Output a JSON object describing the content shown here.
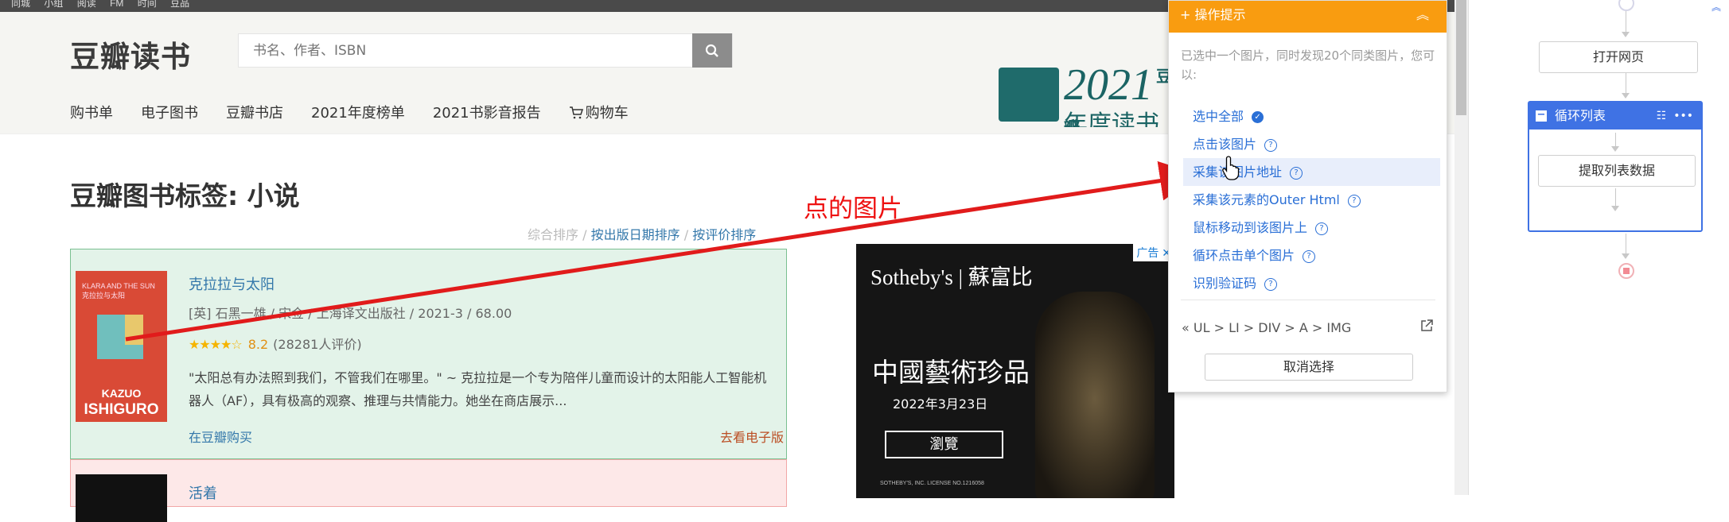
{
  "topbar": {
    "links": [
      "同城",
      "小组",
      "阅读",
      "FM",
      "时间",
      "豆品"
    ]
  },
  "header": {
    "logo": "豆瓣读书",
    "search": {
      "placeholder": "书名、作者、ISBN"
    },
    "nav": [
      "购书单",
      "电子图书",
      "豆瓣书店",
      "2021年度榜单",
      "2021书影音报告",
      "购物车"
    ]
  },
  "banner": {
    "year": "2021",
    "brand": "豆瓣",
    "subtitle": "年度读书榜单"
  },
  "main": {
    "title": "豆瓣图书标签: 小说",
    "sort": {
      "overall": "综合排序",
      "sep": "/",
      "by_date": "按出版日期排序",
      "by_rating": "按评价排序"
    },
    "books": [
      {
        "title": "克拉拉与太阳",
        "pub": "[英] 石黑一雄 / 宋佥 / 上海译文出版社 / 2021-3 / 68.00",
        "stars": "★★★★☆",
        "score": "8.2",
        "ratings": "(28281人评价)",
        "desc": "\"太阳总有办法照到我们，不管我们在哪里。\" ~ 克拉拉是一个专为陪伴儿童而设计的太阳能人工智能机器人（AF），具有极高的观察、推理与共情能力。她坐在商店展示...",
        "buy": "在豆瓣购买",
        "ebook": "去看电子版",
        "cover": {
          "top": "KLARA AND THE SUN",
          "top2": "克拉拉与太阳",
          "author1": "KAZUO",
          "author2": "ISHIGURO"
        }
      },
      {
        "title": "活着"
      }
    ]
  },
  "ad": {
    "tag": "广告",
    "brand": "Sotheby's | 蘇富比",
    "headline": "中國藝術珍品",
    "date": "2022年3月23日",
    "button": "瀏覽",
    "license": "SOTHEBY'S, INC. LICENSE NO.1216058"
  },
  "annotation": {
    "text": "点的图片",
    "color": "#e11b1b"
  },
  "tips": {
    "title": "操作提示",
    "message": "已选中一个图片，同时发现20个同类图片，您可以:",
    "items": [
      "选中全部",
      "点击该图片",
      "采集该图片地址",
      "采集该元素的Outer Html",
      "鼠标移动到该图片上",
      "循环点击单个图片",
      "识别验证码"
    ],
    "breadcrumb": "UL > LI > DIV > A > IMG",
    "cancel": "取消选择"
  },
  "workflow": {
    "open_page": "打开网页",
    "loop": "循环列表",
    "extract": "提取列表数据"
  },
  "colors": {
    "orange": "#f99c10",
    "blue": "#3f72e4",
    "link": "#2a6fd6"
  }
}
